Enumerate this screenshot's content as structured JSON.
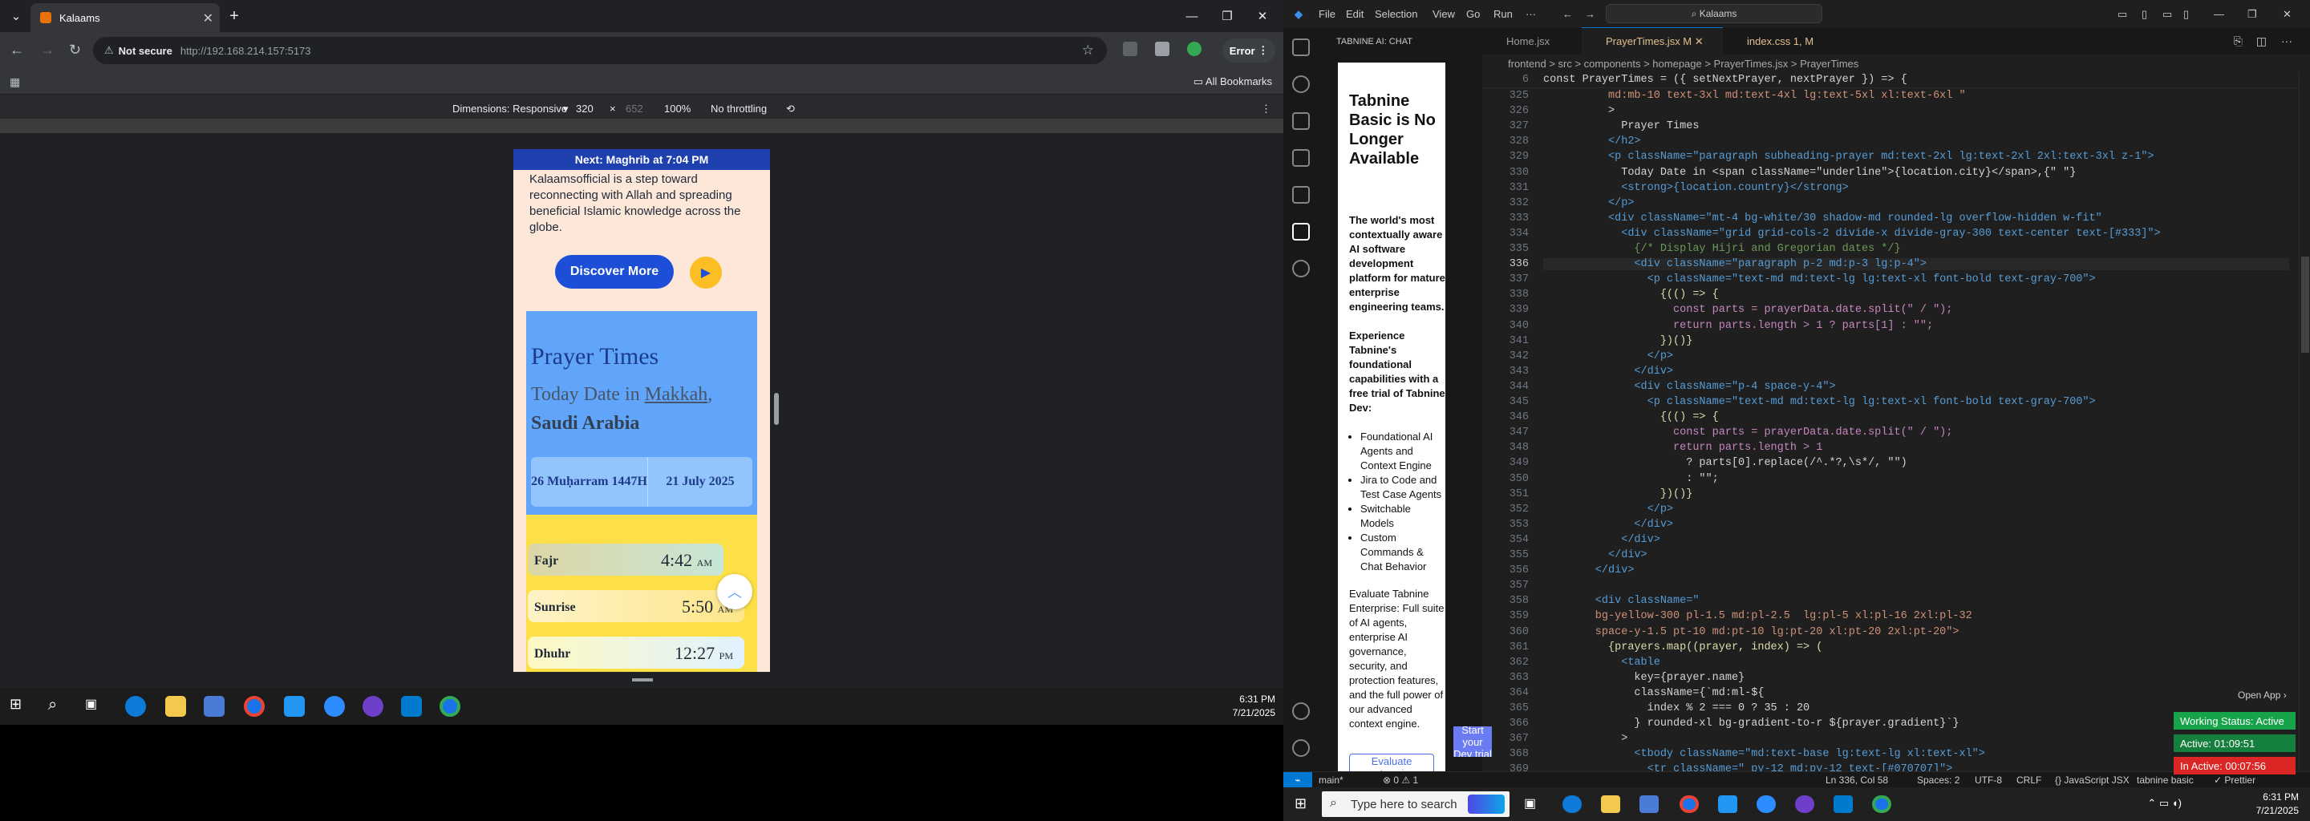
{
  "browser": {
    "tab_title": "Kalaams",
    "new_tab": "+",
    "security": "Not secure",
    "url": "http://192.168.214.157:5173",
    "error_label": "Error",
    "all_bookmarks": "All Bookmarks",
    "devtools": {
      "dimensions": "Dimensions: Responsive",
      "width": "320",
      "times": "×",
      "height": "652",
      "zoom": "100%",
      "throttling": "No throttling"
    }
  },
  "site": {
    "next_prayer_prefix": "Next:",
    "next_prayer_name": "Maghrib",
    "next_prayer_suffix": "at 7:04 PM",
    "intro": "Kalaamsofficial is a step toward reconnecting with Allah and spreading beneficial Islamic knowledge across the globe.",
    "discover_label": "Discover More",
    "prayer_title": "Prayer Times",
    "today_prefix": "Today Date in",
    "city": "Makkah",
    "country": "Saudi Arabia",
    "hijri_date": "26 Muḥarram 1447H",
    "gregorian_date": "21 July 2025",
    "prayers": [
      {
        "name": "Fajr",
        "time": "4:42",
        "ampm": "AM"
      },
      {
        "name": "Sunrise",
        "time": "5:50",
        "ampm": "AM"
      },
      {
        "name": "Dhuhr",
        "time": "12:27",
        "ampm": "PM"
      }
    ]
  },
  "taskbar_left": {
    "time": "6:31 PM",
    "date": "7/21/2025"
  },
  "vscode": {
    "menu": [
      "File",
      "Edit",
      "Selection",
      "View",
      "Go",
      "Run",
      "···"
    ],
    "search": "Kalaams",
    "panel_header": "TABNINE AI: CHAT",
    "tabnine_title": "Tabnine Basic is No Longer Available",
    "tabnine_p1": "The world's most contextually aware AI software development platform for mature enterprise engineering teams.",
    "tabnine_p2": "Experience Tabnine's foundational capabilities with a free trial of Tabnine Dev:",
    "tabnine_list": [
      "Foundational AI Agents and Context Engine",
      "Jira to Code and Test Case Agents",
      "Switchable Models",
      "Custom Commands & Chat Behavior"
    ],
    "tabnine_p3": "Evaluate Tabnine Enterprise: Full suite of AI agents, enterprise AI governance, security, and protection features, and the full power of our advanced context engine.",
    "tabnine_btn1": "Evaluate enterprise",
    "tabnine_btn2": "Start your Dev trial",
    "tabs": [
      {
        "label": "Home.jsx"
      },
      {
        "label": "PrayerTimes.jsx M"
      },
      {
        "label": "index.css 1, M"
      }
    ],
    "breadcrumb": "frontend > src > components > homepage > PrayerTimes.jsx > PrayerTimes",
    "sticky_line_no": "6",
    "sticky_line": "const PrayerTimes = ({ setNextPrayer, nextPrayer }) => {",
    "lines": [
      {
        "n": "325",
        "c": "          md:mb-10 text-3xl md:text-4xl lg:text-5xl xl:text-6xl \""
      },
      {
        "n": "326",
        "c": "          >"
      },
      {
        "n": "327",
        "c": "            Prayer Times"
      },
      {
        "n": "328",
        "c": "          </h2>"
      },
      {
        "n": "329",
        "c": "          <p className=\"paragraph subheading-prayer md:text-2xl lg:text-2xl 2xl:text-3xl z-1\">"
      },
      {
        "n": "330",
        "c": "            Today Date in <span className=\"underline\">{location.city}</span>,{\" \"}"
      },
      {
        "n": "331",
        "c": "            <strong>{location.country}</strong>"
      },
      {
        "n": "332",
        "c": "          </p>"
      },
      {
        "n": "333",
        "c": "          <div className=\"mt-4 bg-white/30 shadow-md rounded-lg overflow-hidden w-fit\""
      },
      {
        "n": "334",
        "c": "            <div className=\"grid grid-cols-2 divide-x divide-gray-300 text-center text-[#333]\">"
      },
      {
        "n": "335",
        "c": "              {/* Display Hijri and Gregorian dates */}"
      },
      {
        "n": "336",
        "c": "              <div className=\"paragraph p-2 md:p-3 lg:p-4\">"
      },
      {
        "n": "337",
        "c": "                <p className=\"text-md md:text-lg lg:text-xl font-bold text-gray-700\">"
      },
      {
        "n": "338",
        "c": "                  {(() => {"
      },
      {
        "n": "339",
        "c": "                    const parts = prayerData.date.split(\" / \");"
      },
      {
        "n": "340",
        "c": "                    return parts.length > 1 ? parts[1] : \"\";"
      },
      {
        "n": "341",
        "c": "                  })()}"
      },
      {
        "n": "342",
        "c": "                </p>"
      },
      {
        "n": "343",
        "c": "              </div>"
      },
      {
        "n": "344",
        "c": "              <div className=\"p-4 space-y-4\">"
      },
      {
        "n": "345",
        "c": "                <p className=\"text-md md:text-lg lg:text-xl font-bold text-gray-700\">"
      },
      {
        "n": "346",
        "c": "                  {(() => {"
      },
      {
        "n": "347",
        "c": "                    const parts = prayerData.date.split(\" / \");"
      },
      {
        "n": "348",
        "c": "                    return parts.length > 1"
      },
      {
        "n": "349",
        "c": "                      ? parts[0].replace(/^.*?,\\s*/, \"\")"
      },
      {
        "n": "350",
        "c": "                      : \"\";"
      },
      {
        "n": "351",
        "c": "                  })()}"
      },
      {
        "n": "352",
        "c": "                </p>"
      },
      {
        "n": "353",
        "c": "              </div>"
      },
      {
        "n": "354",
        "c": "            </div>"
      },
      {
        "n": "355",
        "c": "          </div>"
      },
      {
        "n": "356",
        "c": "        </div>"
      },
      {
        "n": "357",
        "c": ""
      },
      {
        "n": "358",
        "c": "        <div className=\""
      },
      {
        "n": "359",
        "c": "        bg-yellow-300 pl-1.5 md:pl-2.5  lg:pl-5 xl:pl-16 2xl:pl-32"
      },
      {
        "n": "360",
        "c": "        space-y-1.5 pt-10 md:pt-10 lg:pt-20 xl:pt-20 2xl:pt-20\">"
      },
      {
        "n": "361",
        "c": "          {prayers.map((prayer, index) => ("
      },
      {
        "n": "362",
        "c": "            <table"
      },
      {
        "n": "363",
        "c": "              key={prayer.name}"
      },
      {
        "n": "364",
        "c": "              className={`md:ml-${"
      },
      {
        "n": "365",
        "c": "                index % 2 === 0 ? 35 : 20"
      },
      {
        "n": "366",
        "c": "              } rounded-xl bg-gradient-to-r ${prayer.gradient}`}"
      },
      {
        "n": "367",
        "c": "            >"
      },
      {
        "n": "368",
        "c": "              <tbody className=\"md:text-base lg:text-lg xl:text-xl\">"
      },
      {
        "n": "369",
        "c": "                <tr className=\" py-12 md:py-12 text-[#070707]\">"
      }
    ],
    "open_app": "Open App ›",
    "work_status": "Working Status: Active",
    "active_time": "Active: 01:09:51",
    "inactive_time": "In Active: 00:07:56",
    "status": {
      "branch": "main*",
      "problems": "⊗ 0 ⚠ 1",
      "position": "Ln 336, Col 58",
      "spaces": "Spaces: 2",
      "encoding": "UTF-8",
      "eol": "CRLF",
      "language": "{} JavaScript JSX",
      "tabnine": "tabnine basic",
      "prettier": "✓ Prettier"
    }
  },
  "taskbar_right": {
    "search_placeholder": "Type here to search",
    "time": "6:31 PM",
    "date": "7/21/2025"
  }
}
